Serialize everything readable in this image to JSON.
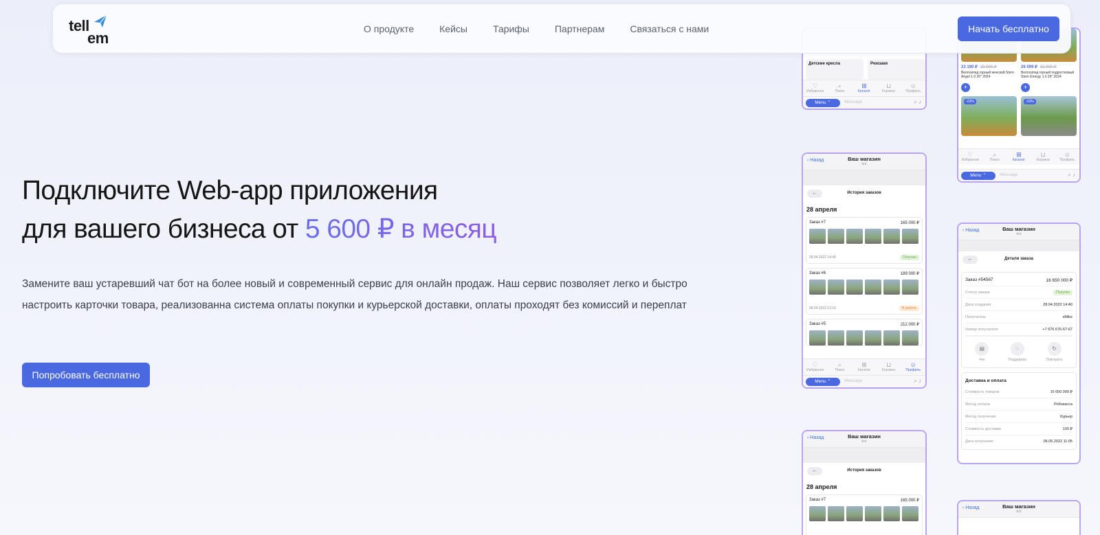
{
  "header": {
    "logo_top": "tell",
    "logo_bottom": "em",
    "nav": [
      "О продукте",
      "Кейсы",
      "Тарифы",
      "Партнерам",
      "Связаться с нами"
    ],
    "cta": "Начать бесплатно"
  },
  "hero": {
    "title_line1": "Подключите Web-app приложения",
    "title_line2_start": "для вашего бизнеса от ",
    "title_accent": "5 600 ₽ в месяц",
    "description": "Замените ваш устаревший чат бот на более новый и современный сервис для онлайн продаж. Наш сервис позволяет легко и быстро настроить карточки товара, реализованна система оплаты покупки и курьерской доставки, оплаты проходят без комиссий и переплат",
    "cta": "Попробовать бесплатно"
  },
  "phone": {
    "back": "Назад",
    "shop": "Ваш магазин",
    "bot": "bot",
    "back_arrow": "←",
    "orders_title": "История заказов",
    "date": "28 апреля",
    "tabs": [
      {
        "icon": "♡",
        "label": "Избранное"
      },
      {
        "icon": "⌕",
        "label": "Поиск"
      },
      {
        "icon": "⊞",
        "label": "Каталог"
      },
      {
        "icon": "⊔",
        "label": "Корзина"
      },
      {
        "icon": "☺",
        "label": "Профиль"
      }
    ],
    "menu": "Menu ⌃",
    "message": "Message",
    "msg_icons": "⌕ ♪",
    "orders": [
      {
        "title": "Заказ #7",
        "sum": "165 000 ₽",
        "date": "28.04.2022 14:40",
        "status": "Получен"
      },
      {
        "title": "Заказ #6",
        "sum": "189 000 ₽",
        "date": "28.04.2022 12:10",
        "status": "В работе"
      },
      {
        "title": "Заказ #5",
        "sum": "212 000 ₽"
      }
    ],
    "catalog": {
      "cat_labels": [
        "Детские кресла",
        "Рюкзаки"
      ],
      "products": [
        {
          "price": "23 190 ₽",
          "old": "29 990 ₽",
          "name": "Велосипед горный женский Stern Angel 1.0 26\" 2024"
        },
        {
          "price": "26 099 ₽",
          "old": "32 990 ₽",
          "name": "Велосипед горный подростковый Stern Energy 1.0 26\" 2024"
        }
      ],
      "plus": "+",
      "discount": "-23%"
    },
    "detail": {
      "title": "Детали заказа",
      "order_no": "Заказ #54567",
      "order_sum": "16 650 000 ₽",
      "rows": [
        {
          "k": "Статус заказа",
          "v": "Получен"
        },
        {
          "k": "Дата создания",
          "v": "28.04.2022 14:40"
        },
        {
          "k": "Получатель",
          "v": "sMike"
        },
        {
          "k": "Номер получателя",
          "v": "+7 676 676-67-67"
        }
      ],
      "actions": [
        {
          "icon": "▤",
          "label": "Чек"
        },
        {
          "icon": "◌",
          "label": "Поддержка"
        },
        {
          "icon": "↻",
          "label": "Повторить"
        }
      ],
      "delivery_title": "Доставка и оплата",
      "delivery": [
        {
          "k": "Стоимость товаров",
          "v": "16 650 000 ₽"
        },
        {
          "k": "Метод оплаты",
          "v": "Робокасса"
        },
        {
          "k": "Метод получения",
          "v": "Курьер"
        },
        {
          "k": "Стоимость доставки",
          "v": "100 ₽"
        },
        {
          "k": "Дата получения",
          "v": "06.05.2022 11:05"
        }
      ]
    }
  },
  "colors": {
    "accent": "#4a68e0",
    "accent_gradient_start": "#6a6ee8",
    "accent_gradient_end": "#8d5de2",
    "phone_border": "#b8a4ee"
  }
}
